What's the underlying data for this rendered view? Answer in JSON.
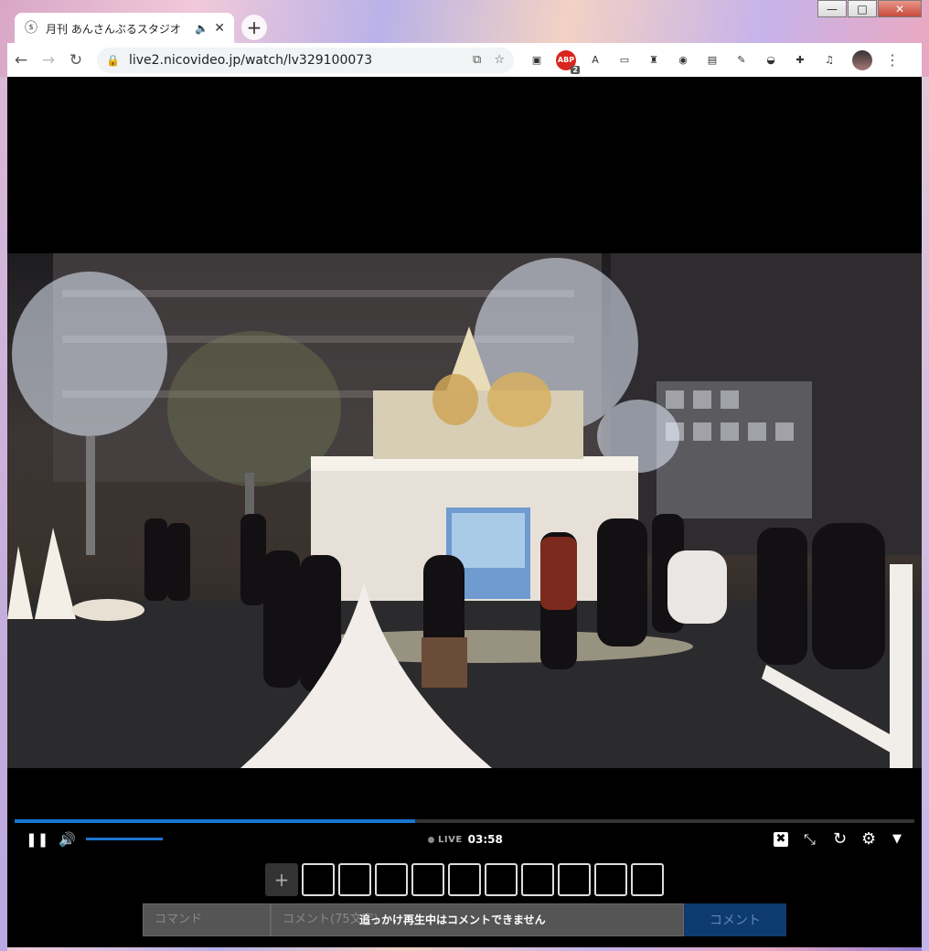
{
  "window": {
    "minimize_glyph": "—",
    "maximize_glyph": "□",
    "close_glyph": "✕"
  },
  "tab": {
    "title": "月刊 あんさんぶるスタジオ",
    "favicon": "niconico-icon",
    "audio_icon": "speaker-icon",
    "close_glyph": "✕"
  },
  "toolbar": {
    "back_glyph": "←",
    "forward_glyph": "→",
    "reload_glyph": "↻",
    "url": "live2.nicovideo.jp/watch/lv329100073",
    "menu_glyph": "⋮"
  },
  "extensions": [
    {
      "name": "ext-square-icon",
      "glyph": "▣"
    },
    {
      "name": "adblock-icon",
      "glyph": "ABP",
      "badge": "2"
    },
    {
      "name": "ext-a-icon",
      "glyph": "A"
    },
    {
      "name": "ext-ticket-icon",
      "glyph": "▭"
    },
    {
      "name": "ext-hat-icon",
      "glyph": "♜"
    },
    {
      "name": "ext-circle-icon",
      "glyph": "◉"
    },
    {
      "name": "ext-card-icon",
      "glyph": "▤"
    },
    {
      "name": "ext-feather-icon",
      "glyph": "✎"
    },
    {
      "name": "ext-disk-icon",
      "glyph": "◒"
    },
    {
      "name": "puzzle-icon",
      "glyph": "✚"
    },
    {
      "name": "media-list-icon",
      "glyph": "♫"
    }
  ],
  "player": {
    "progress_fraction": 0.445,
    "volume_fraction": 1.0,
    "live_label": "LIVE",
    "time": "03:58",
    "play_glyph": "❚❚",
    "volume_glyph": "🔊",
    "comment_toggle_glyph": "✖",
    "shrink_glyph": "⤡",
    "reload_glyph": "↻",
    "settings_glyph": "⚙",
    "more_glyph": "▼"
  },
  "gifts": {
    "add_glyph": "+",
    "slot_count": 10
  },
  "comment_form": {
    "command_placeholder": "コマンド",
    "comment_placeholder": "コメント(75文字)",
    "disabled_message": "追っかけ再生中はコメントできません",
    "submit_label": "コメント"
  }
}
